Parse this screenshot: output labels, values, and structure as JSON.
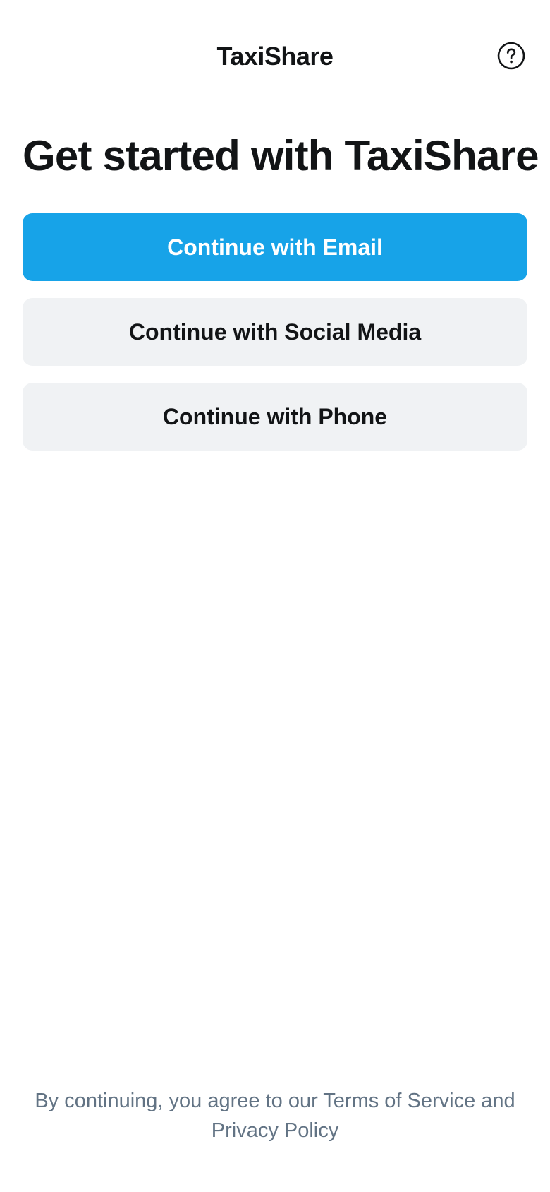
{
  "header": {
    "title": "TaxiShare",
    "help_icon": "help-circle-icon"
  },
  "main": {
    "heading": "Get started with TaxiShare",
    "buttons": [
      {
        "label": "Continue with Email",
        "style": "primary"
      },
      {
        "label": "Continue with Social Media",
        "style": "secondary"
      },
      {
        "label": "Continue with Phone",
        "style": "secondary"
      }
    ]
  },
  "footer": {
    "prefix": "By continuing, you agree to our ",
    "terms_link": "Terms of Service",
    "conjunction": " and ",
    "privacy_link": "Privacy Policy"
  },
  "colors": {
    "accent": "#17a3e8",
    "secondary_button_bg": "#f0f2f4",
    "text_primary": "#121416",
    "text_muted": "#627384"
  }
}
